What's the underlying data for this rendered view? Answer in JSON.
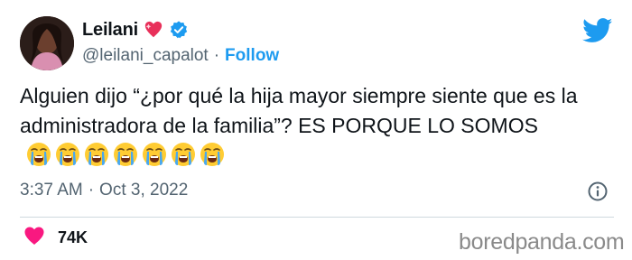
{
  "tweet": {
    "author": {
      "name": "Leilani",
      "handle": "@leilani_capalot",
      "verified": true,
      "name_badge_icon": "sparkling-heart-icon",
      "avatar_icon": "profile-photo"
    },
    "follow_label": "Follow",
    "separator": "·",
    "text": "Alguien dijo “¿por qué la hija mayor siempre siente que es la administradora de la familia”? ES PORQUE LO SOMOS",
    "emoji_name": "loudly-crying-face-emoji",
    "emoji_count": 7,
    "time": "3:37 AM",
    "date": "Oct 3, 2022",
    "likes": "74K"
  },
  "watermark": "boredpanda.com",
  "colors": {
    "accent": "#1d9bf0",
    "like_heart": "#f91880",
    "text": "#0f1419",
    "secondary": "#536471"
  }
}
